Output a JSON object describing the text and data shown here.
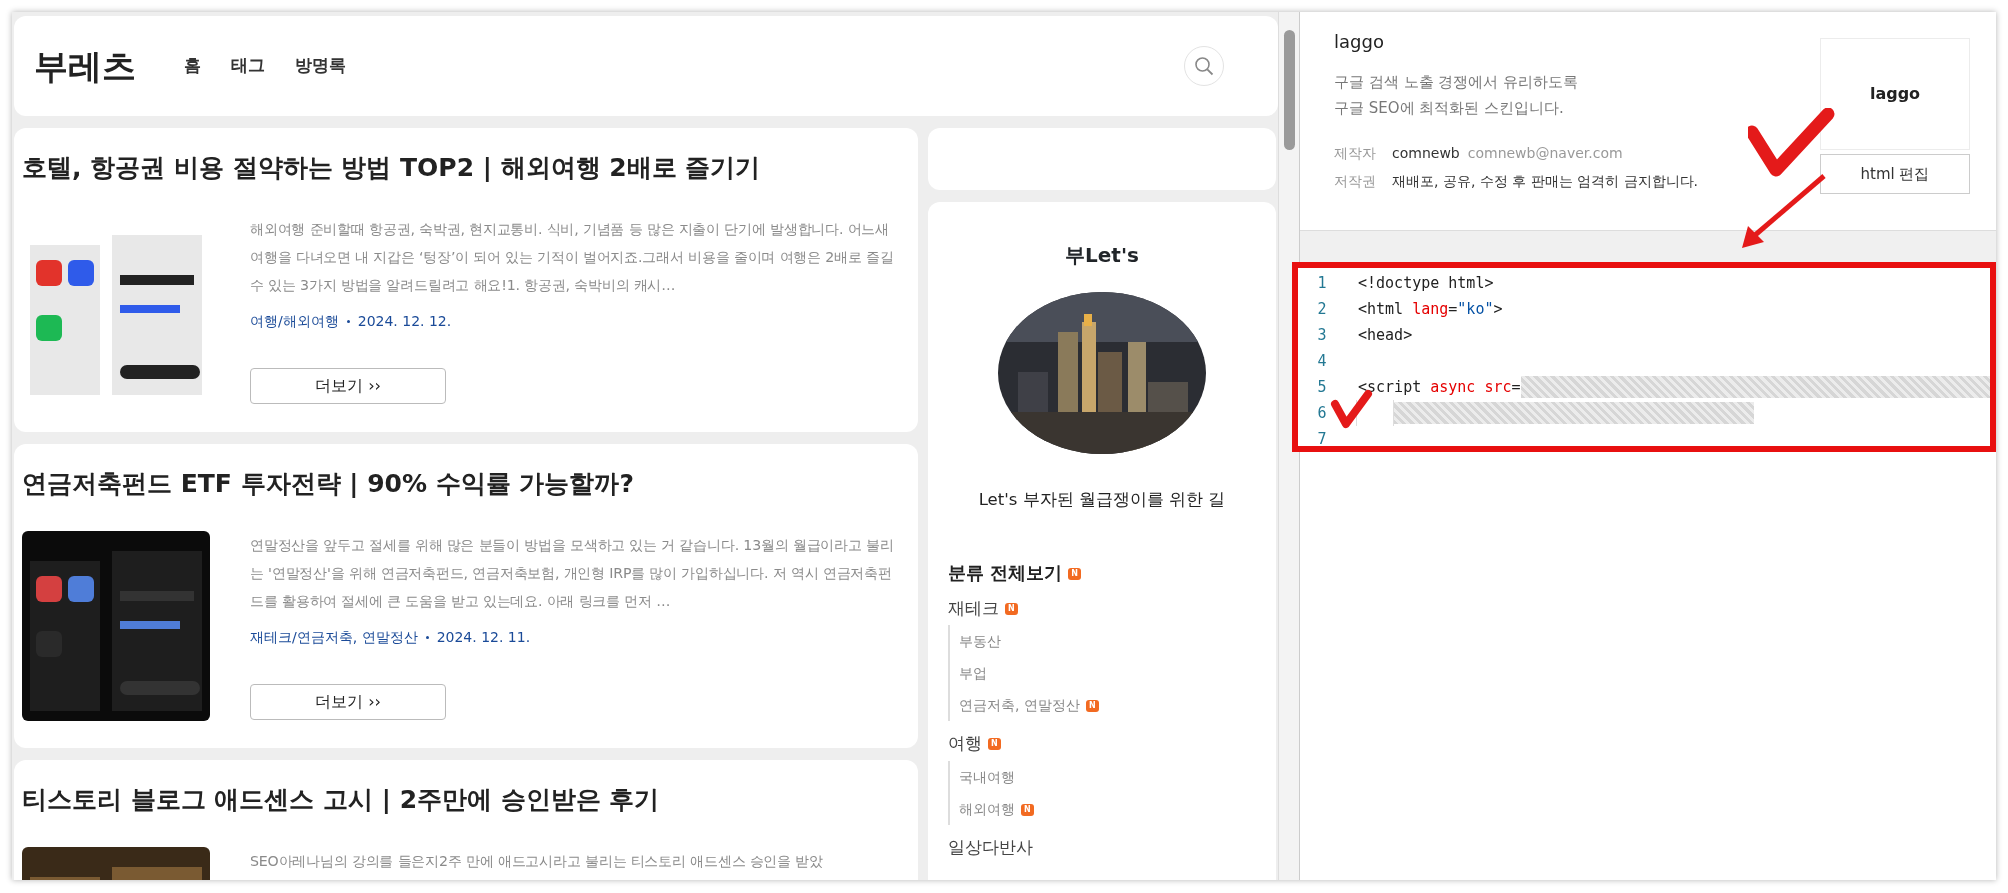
{
  "blog": {
    "title": "부레츠",
    "nav": [
      {
        "label": "홈"
      },
      {
        "label": "태그"
      },
      {
        "label": "방명록"
      }
    ]
  },
  "posts": [
    {
      "title": "호텔, 항공권 비용 절약하는 방법 TOP2 | 해외여행 2배로 즐기기",
      "excerpt": "해외여행 준비할때 항공권, 숙박권, 현지교통비. 식비, 기념품 등 많은 지출이 단기에 발생합니다. 어느새 여행을 다녀오면 내 지갑은 ‘텅장’이 되어 있는 기적이 벌어지죠.그래서 비용을 줄이며 여행은 2배로 즐길 수 있는 3가지 방법을 알려드릴려고 해요!1. 항공권, 숙박비의 캐시…",
      "category": "여행/해외여행",
      "date": "2024. 12. 12.",
      "more": "더보기 ››"
    },
    {
      "title": "연금저축펀드 ETF 투자전략 | 90% 수익률 가능할까?",
      "excerpt": "연말정산을 앞두고 절세를 위해 많은 분들이 방법을 모색하고 있는 거 같습니다. 13월의 월급이라고 불리는 '연말정산'을 위해 연금저축펀드, 연금저축보험, 개인형 IRP를 많이 가입하십니다. 저 역시 연금저축펀드를 활용하여 절세에 큰 도움을 받고 있는데요. 아래 링크를 먼저 …",
      "category": "재테크/연금저축, 연말정산",
      "date": "2024. 12. 11.",
      "more": "더보기 ››"
    },
    {
      "title": "티스토리 블로그 애드센스 고시 | 2주만에 승인받은 후기",
      "excerpt": "SEO아레나님의 강의를 들은지2주 만에 애드고시라고 불리는 티스토리 애드센스 승인을 받았"
    }
  ],
  "sidebar": {
    "profile": {
      "name": "부Let's",
      "description": "Let's 부자된 월급쟁이를 위한 길"
    },
    "categories": {
      "title": "분류 전체보기",
      "badge": "N",
      "items": [
        {
          "label": "재테크",
          "badge": "N",
          "children": [
            {
              "label": "부동산"
            },
            {
              "label": "부업"
            },
            {
              "label": "연금저축, 연말정산",
              "badge": "N"
            }
          ]
        },
        {
          "label": "여행",
          "badge": "N",
          "children": [
            {
              "label": "국내여행"
            },
            {
              "label": "해외여행",
              "badge": "N"
            }
          ]
        },
        {
          "label": "일상다반사"
        }
      ]
    }
  },
  "skin": {
    "name": "laggo",
    "description": [
      "구글 검색 노출 경쟁에서 유리하도록",
      "구글 SEO에 최적화된 스킨입니다."
    ],
    "details": [
      {
        "label": "제작자",
        "value": "comnewb",
        "extra": "comnewb@naver.com"
      },
      {
        "label": "저작권",
        "value": "재배포, 공유, 수정 후 판매는 엄격히 금지합니다."
      }
    ],
    "logo": "laggo",
    "edit_button": "html 편집"
  },
  "editor": {
    "lines": [
      {
        "number": "1",
        "tokens": [
          {
            "kind": "tag",
            "text": "<!doctype html>"
          }
        ]
      },
      {
        "number": "2",
        "tokens": [
          {
            "kind": "tag",
            "text": "<html "
          },
          {
            "kind": "attr",
            "text": "lang"
          },
          {
            "kind": "tag",
            "text": "="
          },
          {
            "kind": "string",
            "text": "\"ko\""
          },
          {
            "kind": "tag",
            "text": ">"
          }
        ]
      },
      {
        "number": "3",
        "tokens": [
          {
            "kind": "tag",
            "text": "<head>"
          }
        ]
      },
      {
        "number": "4"
      },
      {
        "number": "5",
        "tokens": [
          {
            "kind": "tag",
            "text": "<script "
          },
          {
            "kind": "attr",
            "text": "async src"
          },
          {
            "kind": "tag",
            "text": "="
          }
        ],
        "redacted": true
      },
      {
        "number": "6",
        "redacted": true,
        "indent": true
      },
      {
        "number": "7"
      }
    ]
  }
}
